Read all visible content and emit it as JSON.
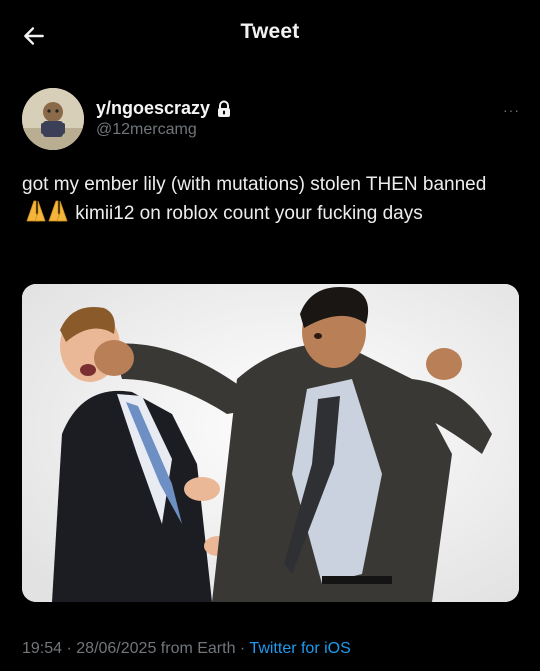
{
  "header": {
    "title": "Tweet",
    "back_icon": "arrow-left-icon"
  },
  "author": {
    "display_name": "y/ngoescrazy",
    "handle": "@12mercamg",
    "lock_icon": "lock-icon",
    "more_icon": "more-icon",
    "more_text": "···"
  },
  "tweet": {
    "text_part1": "got my ember lily (with mutations) stolen THEN banned ",
    "emoji": "praying-hands-icon",
    "text_part2": " kimii12 on roblox count your fucking days"
  },
  "media": {
    "description_icon": "photo-two-businessmen-punch"
  },
  "meta": {
    "time": "19:54",
    "separator1": " · ",
    "date": "28/06/2025",
    "location": " from Earth",
    "separator2": " · ",
    "client": "Twitter for iOS"
  },
  "colors": {
    "background": "#000000",
    "link": "#1d9bf0",
    "muted": "#71767b",
    "text": "#e7e9ea"
  }
}
